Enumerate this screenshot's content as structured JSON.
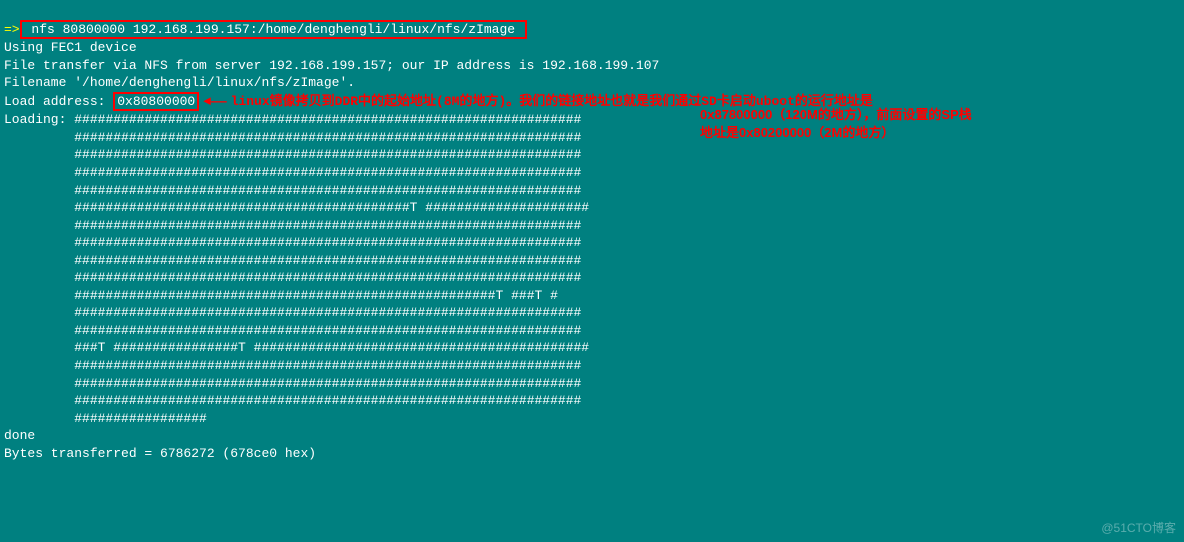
{
  "prompt": "=>",
  "cmd": " nfs 80800000 192.168.199.157:/home/denghengli/linux/nfs/zImage ",
  "line_device": "Using FEC1 device",
  "line_transfer": "File transfer via NFS from server 192.168.199.157; our IP address is 192.168.199.107",
  "line_filename": "Filename '/home/denghengli/linux/nfs/zImage'.",
  "load_label": "Load address: ",
  "load_addr": "0x80800000",
  "loading_label": "Loading:",
  "hash_rows": [
    "#################################################################",
    "#################################################################",
    "#################################################################",
    "#################################################################",
    "#################################################################",
    "###########################################T #####################",
    "#################################################################",
    "#################################################################",
    "#################################################################",
    "#################################################################",
    "######################################################T ###T #",
    "#################################################################",
    "#################################################################",
    "###T ################T ###########################################",
    "#################################################################",
    "#################################################################",
    "#################################################################",
    "#################"
  ],
  "done": "done",
  "bytes": "Bytes transferred = 6786272 (678ce0 hex)",
  "annot1": "linux镜像拷贝到DDR中的起始地址(8M的地方)。我们的链接地址也就是我们通过SD卡启动uboot的运行地址是",
  "annot2": "0x87800000（120M的地方），前面设置的SP栈",
  "annot3": "地址是0x80200000（2M的地方）",
  "arrow": "◄——",
  "watermark": "@51CTO博客"
}
